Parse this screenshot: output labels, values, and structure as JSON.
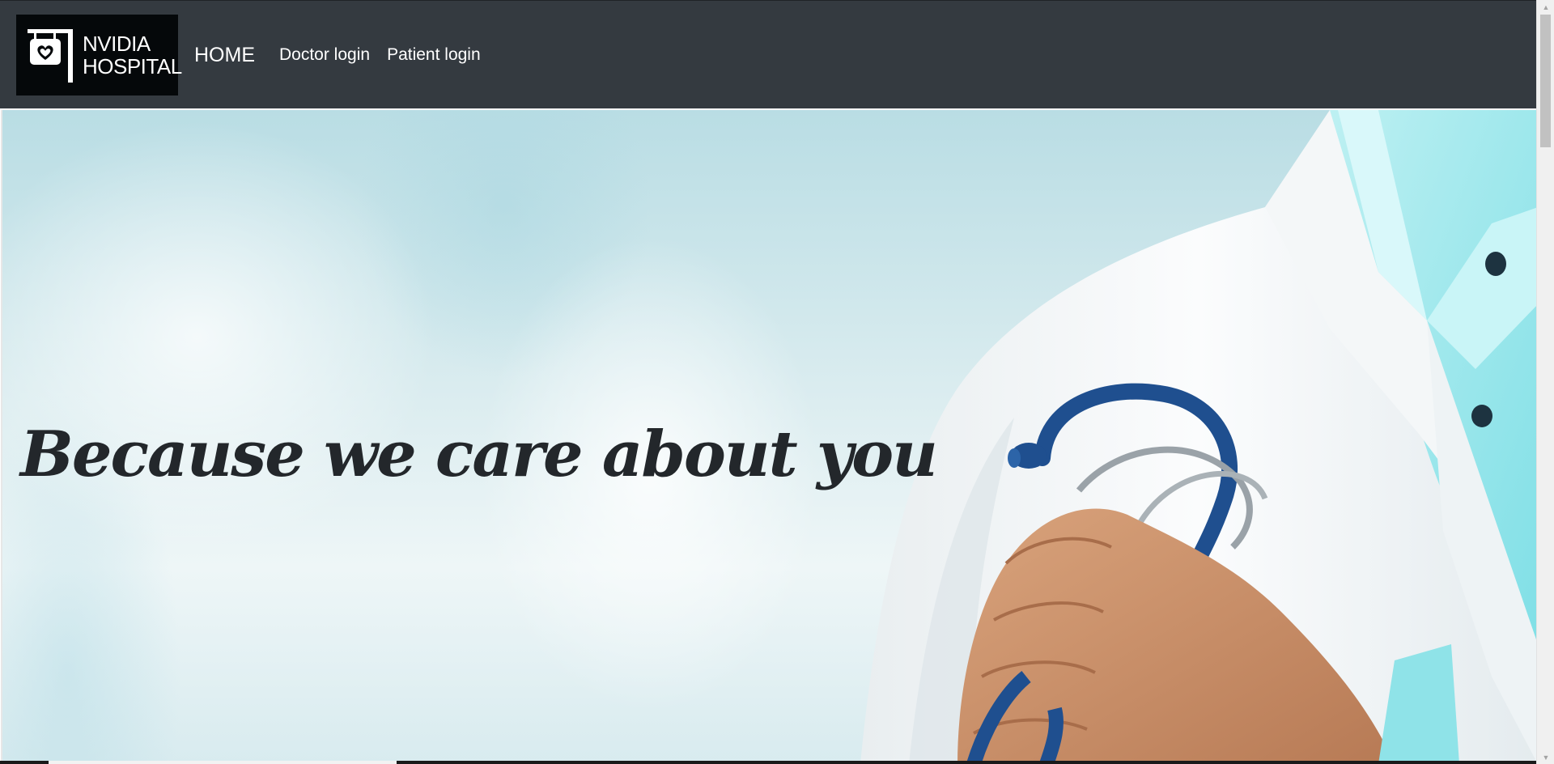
{
  "navbar": {
    "logo_line1": "NVIDIA",
    "logo_line2": "HOSPITAL",
    "home_label": "HOME",
    "doctor_login_label": "Doctor login",
    "patient_login_label": "Patient login",
    "background_color": "#343a40"
  },
  "hero": {
    "headline": "Because we care about you",
    "image_subject": "doctor in white coat holding stethoscope"
  },
  "icons": {
    "logo_icon": "hospital-sign-heart-icon",
    "scroll_up": "chevron-up-icon",
    "scroll_down": "chevron-down-icon"
  },
  "colors": {
    "headline": "#23272b",
    "nav_text": "#ffffff",
    "logo_bg": "#05080a"
  }
}
